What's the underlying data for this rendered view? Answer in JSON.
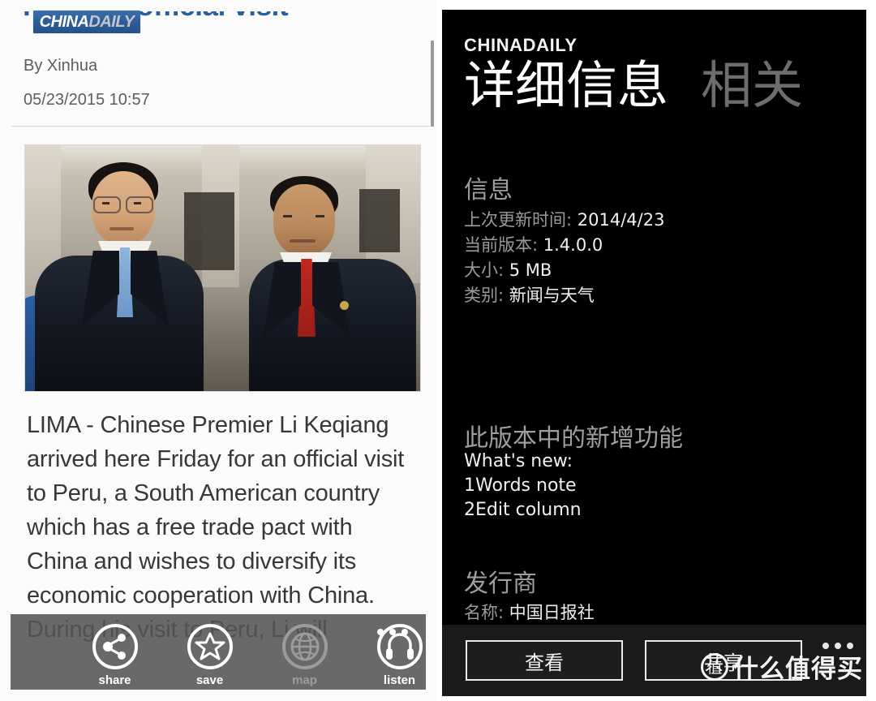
{
  "left_panel": {
    "brand": {
      "part1": "CHINA",
      "part2": "DAILY"
    },
    "headline": "Peru for official visit",
    "byline": "By Xinhua",
    "pubdate": "05/23/2015 10:57",
    "body": "LIMA - Chinese Premier Li Keqiang arrived here Friday for an official visit to Peru, a South American country which has a free trade pact with China and wishes to diversify its economic cooperation with China. During his visit to Peru, Li will",
    "app_bar": {
      "items": [
        {
          "icon": "share-icon",
          "label": "share",
          "enabled": true
        },
        {
          "icon": "star-icon",
          "label": "save",
          "enabled": true
        },
        {
          "icon": "globe-icon",
          "label": "map",
          "enabled": false
        },
        {
          "icon": "headset-icon",
          "label": "listen",
          "enabled": true
        }
      ],
      "overflow_icon": "ellipsis-icon"
    }
  },
  "right_panel": {
    "app_name": "CHINADAILY",
    "pivot": {
      "active": "详细信息",
      "inactive": "相关"
    },
    "info": {
      "heading": "信息",
      "rows": [
        {
          "key": "上次更新时间:",
          "value": "2014/4/23"
        },
        {
          "key": "当前版本:",
          "value": "1.4.0.0"
        },
        {
          "key": "大小:",
          "value": "5 MB"
        },
        {
          "key": "类别:",
          "value": "新闻与天气"
        }
      ]
    },
    "whats_new": {
      "heading": "此版本中的新增功能",
      "lines": [
        "What's new:",
        "1Words note",
        "2Edit column"
      ]
    },
    "publisher": {
      "heading": "发行商",
      "row": {
        "key": "名称:",
        "value": "中国日报社"
      }
    },
    "bottom_bar": {
      "view_label": "查看",
      "share_label": "共享",
      "overflow_icon": "ellipsis-icon"
    }
  },
  "watermark": {
    "logo_char": "值",
    "text": "什么值得买"
  },
  "colors": {
    "brand_blue": "#2c5b96",
    "headline_blue": "#2a5f9e",
    "dark_bg": "#000000",
    "pivot_inactive": "#6d6d6d",
    "section_heading": "#9e9e9e"
  }
}
